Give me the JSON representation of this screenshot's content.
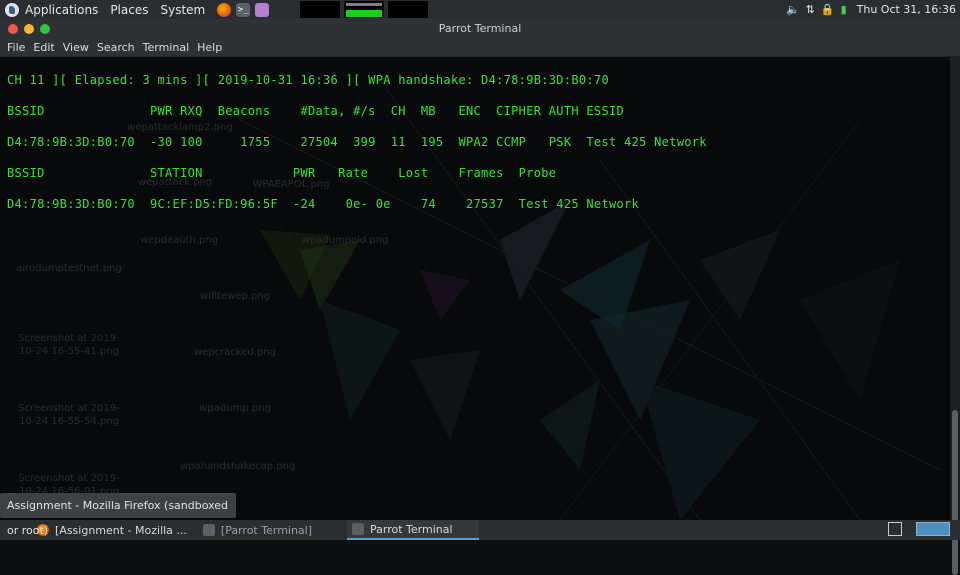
{
  "top_panel": {
    "menus": [
      "Applications",
      "Places",
      "System"
    ],
    "clock": "Thu Oct 31, 16:36"
  },
  "window": {
    "title": "Parrot Terminal",
    "menu": [
      "File",
      "Edit",
      "View",
      "Search",
      "Terminal",
      "Help"
    ]
  },
  "terminal": {
    "lines": [
      "CH 11 ][ Elapsed: 3 mins ][ 2019-10-31 16:36 ][ WPA handshake: D4:78:9B:3D:B0:70",
      "BSSID              PWR RXQ  Beacons    #Data, #/s  CH  MB   ENC  CIPHER AUTH ESSID",
      "D4:78:9B:3D:B0:70  -30 100     1755    27504  399  11  195  WPA2 CCMP   PSK  Test 425 Network",
      "BSSID              STATION            PWR   Rate    Lost    Frames  Probe",
      "D4:78:9B:3D:B0:70  9C:EF:D5:FD:96:5F  -24    0e- 0e    74    27537  Test 425 Network"
    ]
  },
  "desktop_icons": [
    "wepattack.png",
    "wepattacklamp2.png",
    "airodumptestnet.png",
    "wepdeauth.png",
    "wpadumpold.png",
    "WPAEAPOL.png",
    "wifitewep.png",
    "wepcracked.png",
    "wpadump.png",
    "wpahandshakecap.png",
    "Screenshot at 2019-10-24 16-55-41.png",
    "Screenshot at 2019-10-24 16-55-54.png",
    "Screenshot at 2019-10-24 16-56-01.png"
  ],
  "tooltip": "Assignment - Mozilla Firefox (sandboxed or root)",
  "taskbar": {
    "tasks": [
      {
        "label": "[Assignment - Mozilla ..."
      },
      {
        "label": "[Parrot Terminal]"
      },
      {
        "label": "Parrot Terminal"
      }
    ]
  },
  "colors": {
    "terminal_text": "#2ee82e",
    "panel_bg": "#2b2e31",
    "titlebar_bg": "#2f3234"
  }
}
